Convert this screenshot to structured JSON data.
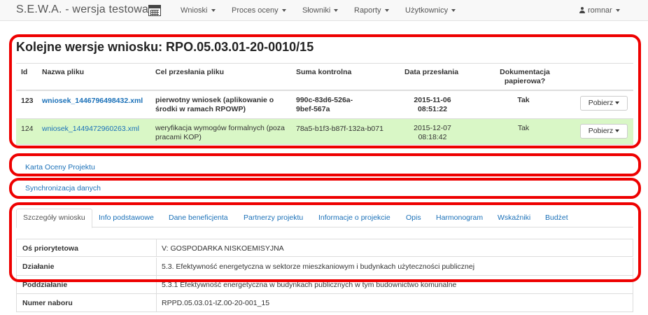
{
  "app": {
    "title": "S.E.W.A. - wersja testowa"
  },
  "nav": {
    "items": [
      {
        "label": "Wnioski"
      },
      {
        "label": "Proces oceny"
      },
      {
        "label": "Słowniki"
      },
      {
        "label": "Raporty"
      },
      {
        "label": "Użytkownicy"
      }
    ],
    "user": "romnar"
  },
  "versions": {
    "title": "Kolejne wersje wniosku: RPO.05.03.01-20-0010/15",
    "headers": {
      "id": "Id",
      "file": "Nazwa pliku",
      "purpose": "Cel przesłania pliku",
      "checksum": "Suma kontrolna",
      "date": "Data przesłania",
      "paper_1": "Dokumentacja",
      "paper_2": "papierowa?"
    },
    "rows": [
      {
        "id": "123",
        "file": "wniosek_1446796498432.xml",
        "purpose_1": "pierwotny wniosek (aplikowanie o",
        "purpose_2": "środki w ramach RPOWP)",
        "checksum_1": "990c-83d6-526a-",
        "checksum_2": "9bef-567a",
        "date_1": "2015-11-06",
        "date_2": "08:51:22",
        "paper": "Tak",
        "action": "Pobierz"
      },
      {
        "id": "124",
        "file": "wniosek_1449472960263.xml",
        "purpose_1": "weryfikacja wymogów formalnych (poza",
        "purpose_2": "pracami KOP)",
        "checksum_1": "78a5-b1f3-b87f-132a-b071",
        "checksum_2": "",
        "date_1": "2015-12-07",
        "date_2": "08:18:42",
        "paper": "Tak",
        "action": "Pobierz"
      }
    ]
  },
  "links": {
    "karta": "Karta Oceny Projektu",
    "sync": "Synchronizacja danych"
  },
  "tabs": [
    {
      "label": "Szczegóły wniosku"
    },
    {
      "label": "Info podstawowe"
    },
    {
      "label": "Dane beneficjenta"
    },
    {
      "label": "Partnerzy projektu"
    },
    {
      "label": "Informacje o projekcie"
    },
    {
      "label": "Opis"
    },
    {
      "label": "Harmonogram"
    },
    {
      "label": "Wskaźniki"
    },
    {
      "label": "Budżet"
    }
  ],
  "details": [
    {
      "key": "Oś priorytetowa",
      "value": "V: GOSPODARKA NISKOEMISYJNA"
    },
    {
      "key": "Działanie",
      "value": "5.3. Efektywność energetyczna w sektorze mieszkaniowym i budynkach użyteczności publicznej"
    },
    {
      "key": "Poddziałanie",
      "value": "5.3.1 Efektywność energetyczna w budynkach publicznych w tym budownictwo komunalne"
    },
    {
      "key": "Numer naboru",
      "value": "RPPD.05.03.01-IZ.00-20-001_15"
    }
  ],
  "colors": {
    "annotation": "#ee0000",
    "highlight_row": "#d9f7c6",
    "link": "#1a70b8"
  }
}
